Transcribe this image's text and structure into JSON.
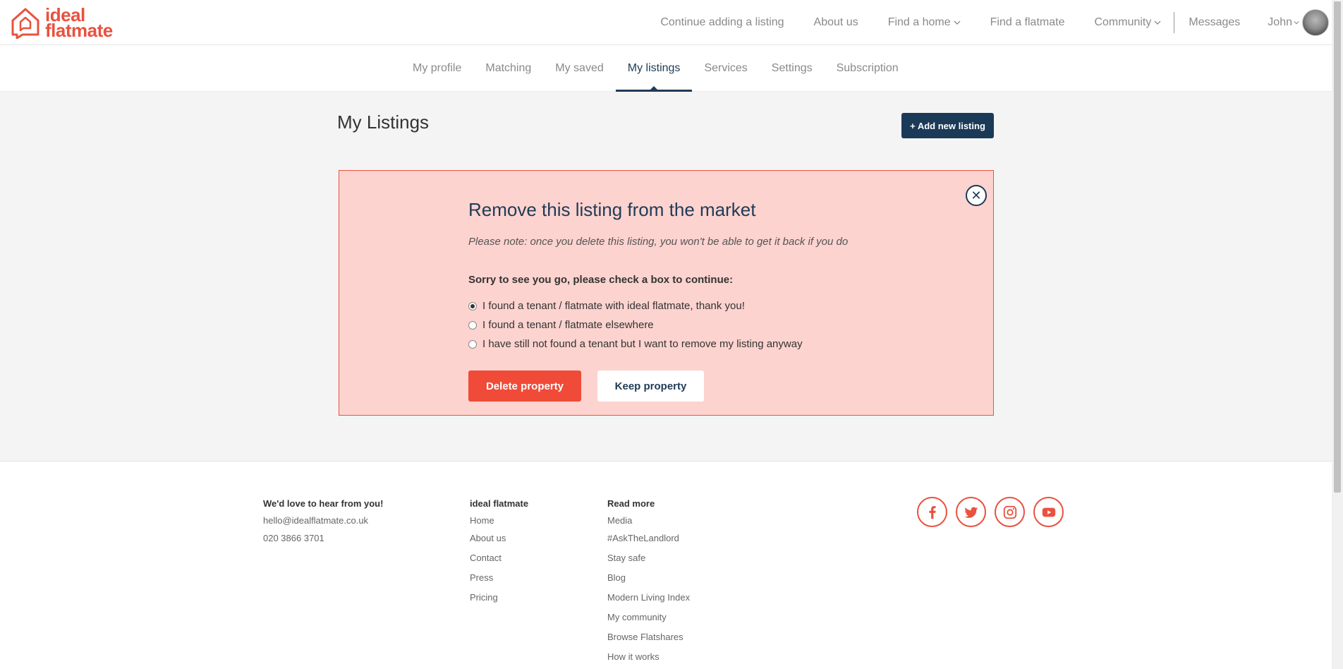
{
  "brand": {
    "line1": "ideal",
    "line2": "flatmate",
    "accent": "#e8523f",
    "navy": "#1b3a57"
  },
  "topnav": {
    "items": [
      {
        "label": "Continue adding a listing",
        "dropdown": false
      },
      {
        "label": "About us",
        "dropdown": false
      },
      {
        "label": "Find a home",
        "dropdown": true
      },
      {
        "label": "Find a flatmate",
        "dropdown": false
      },
      {
        "label": "Community",
        "dropdown": true
      }
    ],
    "messages": "Messages",
    "user": "John"
  },
  "subnav": {
    "tabs": [
      "My profile",
      "Matching",
      "My saved",
      "My listings",
      "Services",
      "Settings",
      "Subscription"
    ],
    "active": "My listings"
  },
  "main": {
    "title": "My Listings",
    "add_button": "+ Add new listing"
  },
  "modal": {
    "title": "Remove this listing from the market",
    "note": "Please note: once you delete this listing, you won't be able to get it back if you do",
    "question": "Sorry to see you go, please check a box to continue:",
    "options": [
      {
        "label": "I found a tenant / flatmate with ideal flatmate, thank you!",
        "selected": true
      },
      {
        "label": "I found a tenant / flatmate elsewhere",
        "selected": false
      },
      {
        "label": "I have still not found a tenant but I want to remove my listing anyway",
        "selected": false
      }
    ],
    "delete_label": "Delete property",
    "keep_label": "Keep property",
    "close_icon": "close-icon"
  },
  "footer": {
    "contact": {
      "heading": "We'd love to hear from you!",
      "email": "hello@idealflatmate.co.uk",
      "phone": "020 3866 3701"
    },
    "col2": {
      "heading": "ideal flatmate",
      "links": [
        "Home",
        "About us",
        "Contact",
        "Press",
        "Pricing"
      ]
    },
    "col3": {
      "heading": "Read more",
      "links": [
        "Media",
        "#AskTheLandlord",
        "Stay safe",
        "Blog",
        "Modern Living Index",
        "My community",
        "Browse Flatshares",
        "How it works"
      ]
    },
    "social": [
      "facebook-icon",
      "twitter-icon",
      "instagram-icon",
      "youtube-icon"
    ]
  }
}
